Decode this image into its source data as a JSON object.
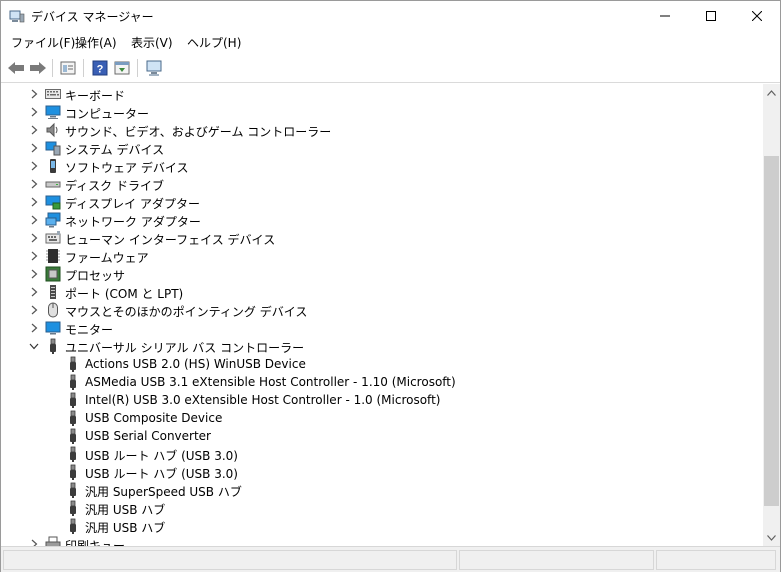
{
  "window": {
    "title": "デバイス マネージャー",
    "icon": "device-manager-icon"
  },
  "menu": [
    {
      "label": "ファイル(F)"
    },
    {
      "label": "操作(A)"
    },
    {
      "label": "表示(V)"
    },
    {
      "label": "ヘルプ(H)"
    }
  ],
  "toolbar": [
    {
      "icon": "back-arrow-icon"
    },
    {
      "icon": "forward-arrow-icon"
    },
    {
      "icon": "properties-icon"
    },
    {
      "icon": "help-icon"
    },
    {
      "icon": "show-hide-console-tree-icon"
    },
    {
      "icon": "scan-hardware-icon"
    }
  ],
  "tree": {
    "items": [
      {
        "label": "キーボード",
        "icon": "keyboard-icon",
        "expander": "collapsed",
        "level": 0
      },
      {
        "label": "コンピューター",
        "icon": "computer-icon",
        "expander": "collapsed",
        "level": 0
      },
      {
        "label": "サウンド、ビデオ、およびゲーム コントローラー",
        "icon": "speaker-icon",
        "expander": "collapsed",
        "level": 0
      },
      {
        "label": "システム デバイス",
        "icon": "system-device-icon",
        "expander": "collapsed",
        "level": 0
      },
      {
        "label": "ソフトウェア デバイス",
        "icon": "software-device-icon",
        "expander": "collapsed",
        "level": 0
      },
      {
        "label": "ディスク ドライブ",
        "icon": "disk-drive-icon",
        "expander": "collapsed",
        "level": 0
      },
      {
        "label": "ディスプレイ アダプター",
        "icon": "display-adapter-icon",
        "expander": "collapsed",
        "level": 0
      },
      {
        "label": "ネットワーク アダプター",
        "icon": "network-adapter-icon",
        "expander": "collapsed",
        "level": 0
      },
      {
        "label": "ヒューマン インターフェイス デバイス",
        "icon": "hid-icon",
        "expander": "collapsed",
        "level": 0
      },
      {
        "label": "ファームウェア",
        "icon": "firmware-icon",
        "expander": "collapsed",
        "level": 0
      },
      {
        "label": "プロセッサ",
        "icon": "processor-icon",
        "expander": "collapsed",
        "level": 0
      },
      {
        "label": "ポート (COM と LPT)",
        "icon": "port-icon",
        "expander": "collapsed",
        "level": 0
      },
      {
        "label": "マウスとそのほかのポインティング デバイス",
        "icon": "mouse-icon",
        "expander": "collapsed",
        "level": 0
      },
      {
        "label": "モニター",
        "icon": "monitor-icon",
        "expander": "collapsed",
        "level": 0
      },
      {
        "label": "ユニバーサル シリアル バス コントローラー",
        "icon": "usb-icon",
        "expander": "expanded",
        "level": 0
      },
      {
        "label": "Actions USB 2.0 (HS) WinUSB Device",
        "icon": "usb-icon",
        "expander": "none",
        "level": 1
      },
      {
        "label": "ASMedia USB 3.1 eXtensible Host Controller - 1.10 (Microsoft)",
        "icon": "usb-icon",
        "expander": "none",
        "level": 1
      },
      {
        "label": "Intel(R) USB 3.0 eXtensible Host Controller - 1.0 (Microsoft)",
        "icon": "usb-icon",
        "expander": "none",
        "level": 1
      },
      {
        "label": "USB Composite Device",
        "icon": "usb-icon",
        "expander": "none",
        "level": 1
      },
      {
        "label": "USB Serial Converter",
        "icon": "usb-icon",
        "expander": "none",
        "level": 1
      },
      {
        "label": "USB ルート ハブ (USB 3.0)",
        "icon": "usb-icon",
        "expander": "none",
        "level": 1
      },
      {
        "label": "USB ルート ハブ (USB 3.0)",
        "icon": "usb-icon",
        "expander": "none",
        "level": 1
      },
      {
        "label": "汎用 SuperSpeed USB ハブ",
        "icon": "usb-icon",
        "expander": "none",
        "level": 1
      },
      {
        "label": "汎用 USB ハブ",
        "icon": "usb-icon",
        "expander": "none",
        "level": 1
      },
      {
        "label": "汎用 USB ハブ",
        "icon": "usb-icon",
        "expander": "none",
        "level": 1
      },
      {
        "label": "印刷キュー",
        "icon": "print-queue-icon",
        "expander": "collapsed",
        "level": 0
      }
    ]
  },
  "scrollbar": {
    "position_fraction": 0.7
  },
  "colors": {
    "accent": "#0078d7",
    "usb_icon": "#3c3c3c",
    "scroll_thumb": "#cdcdcd"
  }
}
